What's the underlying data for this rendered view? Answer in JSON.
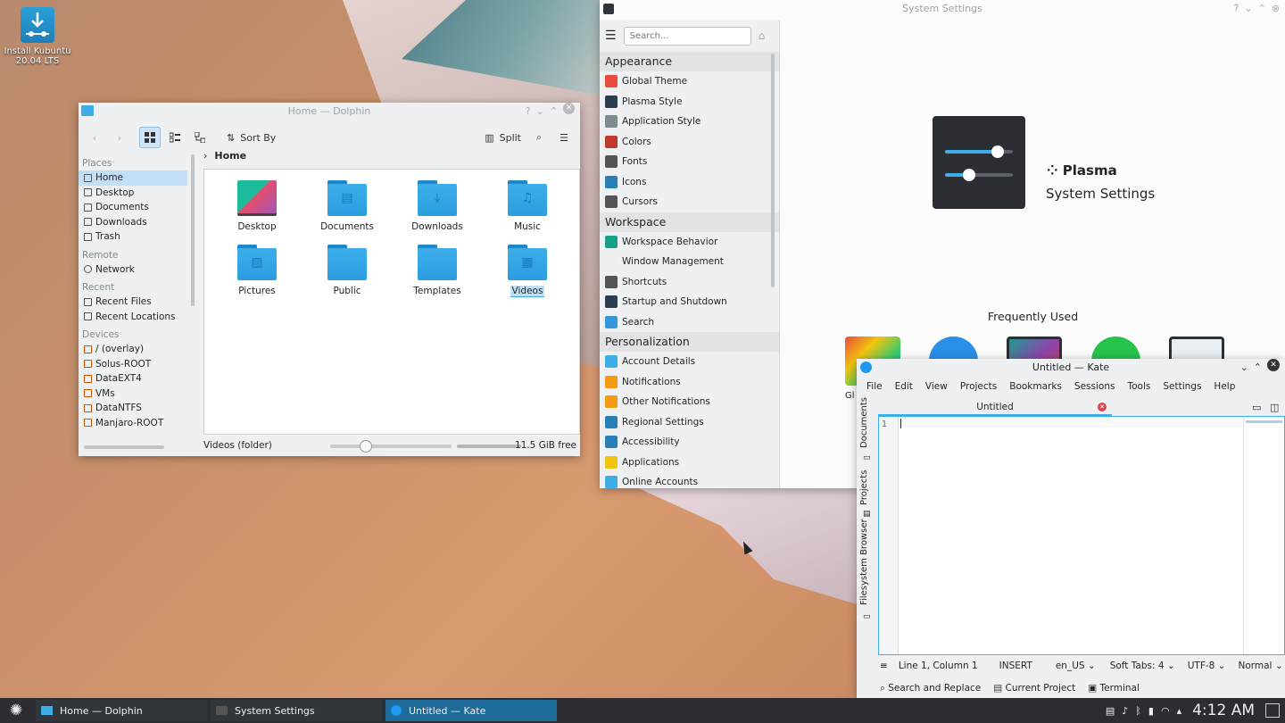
{
  "desktop": {
    "icon_label_1": "Install Kubuntu",
    "icon_label_2": "20.04 LTS"
  },
  "dolphin": {
    "title": "Home — Dolphin",
    "sort_label": "Sort By",
    "split_label": "Split",
    "breadcrumb": "Home",
    "places": {
      "places_header": "Places",
      "places_items": [
        "Home",
        "Desktop",
        "Documents",
        "Downloads",
        "Trash"
      ],
      "remote_header": "Remote",
      "remote_items": [
        "Network"
      ],
      "recent_header": "Recent",
      "recent_items": [
        "Recent Files",
        "Recent Locations"
      ],
      "devices_header": "Devices",
      "devices_items": [
        "/ (overlay)",
        "Solus-ROOT",
        "DataEXT4",
        "VMs",
        "DataNTFS",
        "Manjaro-ROOT"
      ]
    },
    "files": [
      "Desktop",
      "Documents",
      "Downloads",
      "Music",
      "Pictures",
      "Public",
      "Templates",
      "Videos"
    ],
    "status_left": "Videos (folder)",
    "free_space": "11.5 GiB free",
    "zoom_fraction": 0.27,
    "free_fraction": 1.0
  },
  "settings": {
    "title": "System Settings",
    "search_placeholder": "Search...",
    "categories": [
      {
        "name": "Appearance",
        "items": [
          "Global Theme",
          "Plasma Style",
          "Application Style",
          "Colors",
          "Fonts",
          "Icons",
          "Cursors"
        ]
      },
      {
        "name": "Workspace",
        "items": [
          "Workspace Behavior",
          "Window Management",
          "Shortcuts",
          "Startup and Shutdown",
          "Search"
        ]
      },
      {
        "name": "Personalization",
        "items": [
          "Account Details",
          "Notifications",
          "Other Notifications",
          "Regional Settings",
          "Accessibility",
          "Applications",
          "Online Accounts"
        ]
      }
    ],
    "hero_title": "Plasma",
    "hero_subtitle": "System Settings",
    "frequently_used": "Frequently Used",
    "fu_partial_label": "Gl"
  },
  "kate": {
    "title": "Untitled — Kate",
    "menu": [
      "File",
      "Edit",
      "View",
      "Projects",
      "Bookmarks",
      "Sessions",
      "Tools",
      "Settings",
      "Help"
    ],
    "tab": "Untitled",
    "side_tabs": [
      "Documents",
      "Projects",
      "Filesystem Browser"
    ],
    "line_number": "1",
    "status": {
      "position": "Line 1, Column 1",
      "mode": "INSERT",
      "lang": "en_US",
      "tabs": "Soft Tabs: 4",
      "encoding": "UTF-8",
      "syntax": "Normal"
    },
    "bottom": [
      "Search and Replace",
      "Current Project",
      "Terminal"
    ]
  },
  "taskbar": {
    "tasks": [
      "Home — Dolphin",
      "System Settings",
      "Untitled — Kate"
    ],
    "clock": "4:12 AM"
  },
  "colors": {
    "accent": "#3daee9",
    "taskbar": "#2a2e32",
    "active_task": "#1e6a99"
  }
}
